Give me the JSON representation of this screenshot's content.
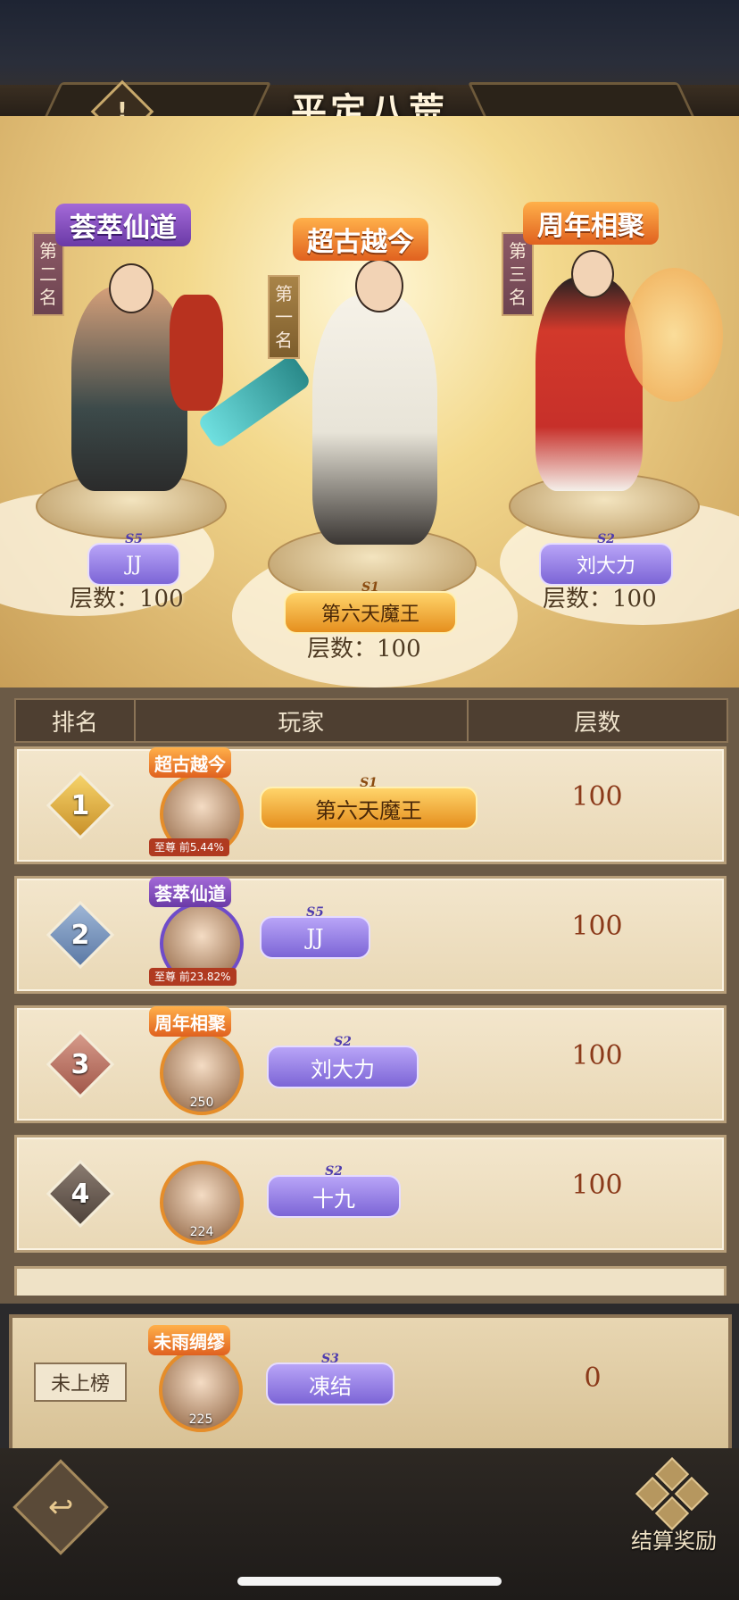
{
  "header": {
    "title": "平定八荒",
    "info_icon": "!"
  },
  "podium": {
    "first": {
      "rank_label": "第一名",
      "title": "超古越今",
      "season": "S1",
      "name": "第六天魔王",
      "floor_text": "层数：100"
    },
    "second": {
      "rank_label": "第二名",
      "title": "荟萃仙道",
      "season": "S5",
      "name": "JJ",
      "floor_text": "层数：100"
    },
    "third": {
      "rank_label": "第三名",
      "title": "周年相聚",
      "season": "S2",
      "name": "刘大力",
      "floor_text": "层数：100"
    }
  },
  "table": {
    "headers": [
      "排名",
      "玩家",
      "层数"
    ],
    "rows": [
      {
        "rank": "1",
        "title": "超古越今",
        "pct": "至尊 前5.44%",
        "season": "S1",
        "name": "第六天魔王",
        "floor": "100",
        "level": ""
      },
      {
        "rank": "2",
        "title": "荟萃仙道",
        "pct": "至尊 前23.82%",
        "season": "S5",
        "name": "JJ",
        "floor": "100",
        "level": ""
      },
      {
        "rank": "3",
        "title": "周年相聚",
        "pct": "",
        "season": "S2",
        "name": "刘大力",
        "floor": "100",
        "level": "250"
      },
      {
        "rank": "4",
        "title": "",
        "pct": "",
        "season": "S2",
        "name": "十九",
        "floor": "100",
        "level": "224"
      }
    ]
  },
  "my_row": {
    "status": "未上榜",
    "title": "未雨绸缪",
    "season": "S3",
    "name": "凍结",
    "floor": "0",
    "level": "225"
  },
  "footer": {
    "back_icon": "↩",
    "reward_label": "结算奖励"
  }
}
